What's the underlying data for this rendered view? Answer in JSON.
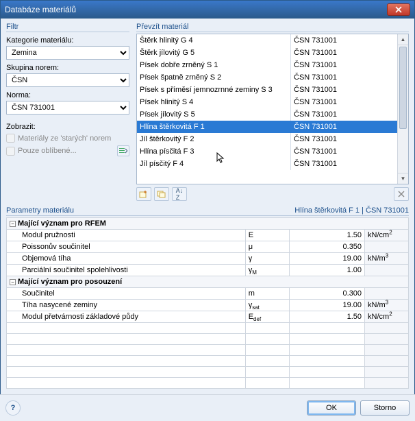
{
  "window": {
    "title": "Databáze materiálů"
  },
  "filter": {
    "section": "Filtr",
    "category_label": "Kategorie materiálu:",
    "category_value": "Zemina",
    "group_label": "Skupina norem:",
    "group_value": "ČSN",
    "norm_label": "Norma:",
    "norm_value": "ČSN 731001",
    "show_label": "Zobrazit:",
    "chk_old": "Materiály ze 'starých' norem",
    "chk_fav": "Pouze oblíbené..."
  },
  "list": {
    "section": "Převzít materiál",
    "items": [
      {
        "name": "Štěrk hlinitý G 4",
        "norm": "ČSN 731001",
        "selected": false
      },
      {
        "name": "Štěrk jílovitý G 5",
        "norm": "ČSN 731001",
        "selected": false
      },
      {
        "name": "Písek dobře zrněný S 1",
        "norm": "ČSN 731001",
        "selected": false
      },
      {
        "name": "Písek špatně zrněný S 2",
        "norm": "ČSN 731001",
        "selected": false
      },
      {
        "name": "Písek s příměsí jemnozrnné zeminy S 3",
        "norm": "ČSN 731001",
        "selected": false
      },
      {
        "name": "Písek hlinitý S 4",
        "norm": "ČSN 731001",
        "selected": false
      },
      {
        "name": "Písek jílovitý S 5",
        "norm": "ČSN 731001",
        "selected": false
      },
      {
        "name": "Hlína štěrkovitá F 1",
        "norm": "ČSN 731001",
        "selected": true
      },
      {
        "name": "Jíl štěrkovitý F 2",
        "norm": "ČSN 731001",
        "selected": false
      },
      {
        "name": "Hlína písčitá F 3",
        "norm": "ČSN 731001",
        "selected": false
      },
      {
        "name": "Jíl písčitý F 4",
        "norm": "ČSN 731001",
        "selected": false
      }
    ],
    "toolbar": {
      "new": "new",
      "dup": "dup",
      "sort": "sort",
      "del": "del"
    }
  },
  "params": {
    "section": "Parametry materiálu",
    "selected_summary": "Hlína štěrkovitá F 1 | ČSN 731001",
    "groups": [
      {
        "title": "Mající význam pro RFEM",
        "rows": [
          {
            "name": "Modul pružnosti",
            "sym": "E",
            "val": "1.50",
            "unit": "kN/cm",
            "sup": "2"
          },
          {
            "name": "Poissonův součinitel",
            "sym": "μ",
            "val": "0.350",
            "unit": ""
          },
          {
            "name": "Objemová tíha",
            "sym": "γ",
            "val": "19.00",
            "unit": "kN/m",
            "sup": "3"
          },
          {
            "name": "Parciální součinitel spolehlivosti",
            "sym": "γ",
            "sub": "M",
            "val": "1.00",
            "unit": ""
          }
        ]
      },
      {
        "title": "Mající význam pro posouzení",
        "rows": [
          {
            "name": "Součinitel",
            "sym": "m",
            "val": "0.300",
            "unit": ""
          },
          {
            "name": "Tíha nasycené zeminy",
            "sym": "γ",
            "sub": "sat",
            "val": "19.00",
            "unit": "kN/m",
            "sup": "3"
          },
          {
            "name": "Modul přetvárnosti základové půdy",
            "sym": "E",
            "sub": "def",
            "val": "1.50",
            "unit": "kN/cm",
            "sup": "2"
          }
        ]
      }
    ]
  },
  "footer": {
    "ok": "OK",
    "cancel": "Storno"
  }
}
